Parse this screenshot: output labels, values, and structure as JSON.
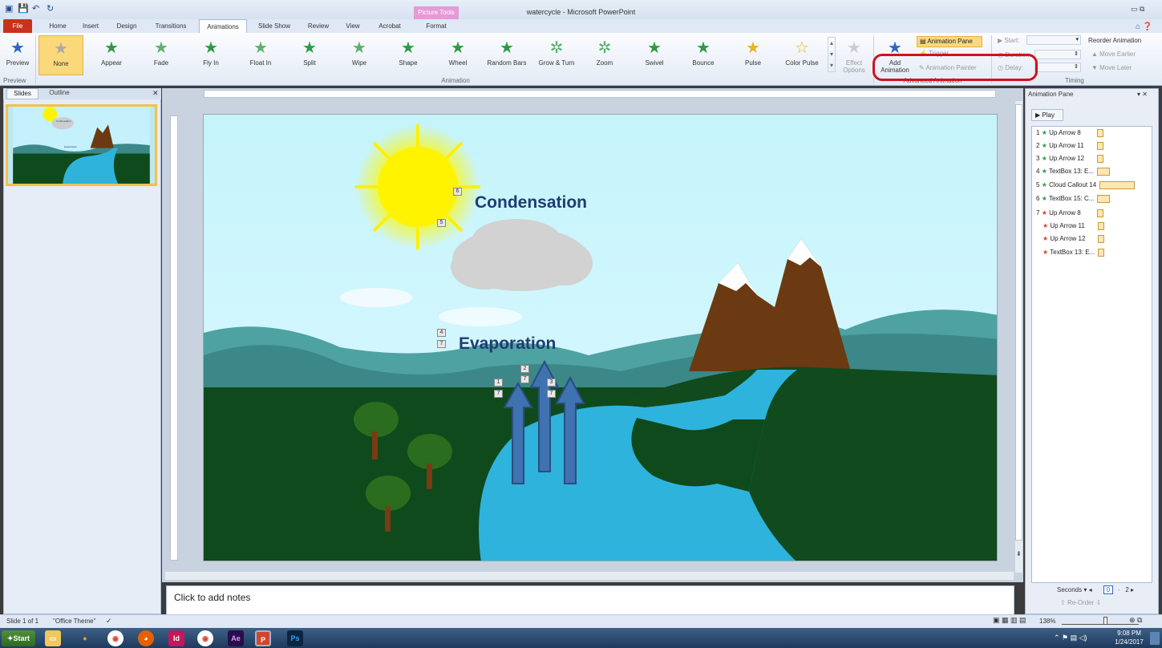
{
  "window": {
    "title": "watercycle - Microsoft PowerPoint",
    "context_tab": "Picture Tools"
  },
  "tabs": [
    "File",
    "Home",
    "Insert",
    "Design",
    "Transitions",
    "Animations",
    "Slide Show",
    "Review",
    "View",
    "Acrobat",
    "Format"
  ],
  "ribbon": {
    "preview_label": "Preview",
    "effects": [
      "None",
      "Appear",
      "Fade",
      "Fly In",
      "Float In",
      "Split",
      "Wipe",
      "Shape",
      "Wheel",
      "Random Bars",
      "Grow & Turn",
      "Zoom",
      "Swivel",
      "Bounce",
      "Pulse",
      "Color Pulse"
    ],
    "effect_options": "Effect Options",
    "add_animation": "Add Animation",
    "animation_pane": "Animation Pane",
    "trigger": "Trigger",
    "animation_painter": "Animation Painter",
    "start": "Start:",
    "duration": "Duration:",
    "delay": "Delay:",
    "reorder": "Reorder Animation",
    "move_earlier": "Move Earlier",
    "move_later": "Move Later",
    "groups": {
      "preview": "Preview",
      "animation": "Animation",
      "advanced": "Advanced Animation",
      "timing": "Timing"
    }
  },
  "left_pane": {
    "tab_slides": "Slides",
    "tab_outline": "Outline",
    "slide_number": "1"
  },
  "slide": {
    "condensation": "Condensation",
    "evaporation": "Evaporation"
  },
  "markers": {
    "m1": "1",
    "m2": "2",
    "m3": "3",
    "m4": "4",
    "m5": "5",
    "m6": "6",
    "m7": "7"
  },
  "thumbnail": {
    "condensation": "Condensation",
    "evaporation": "Evaporation"
  },
  "notes_placeholder": "Click to add notes",
  "animation_pane": {
    "title": "Animation Pane",
    "play": "Play",
    "items": [
      {
        "n": "1",
        "icon": "green-star",
        "label": "Up Arrow 8"
      },
      {
        "n": "2",
        "icon": "green-star",
        "label": "Up Arrow 11"
      },
      {
        "n": "3",
        "icon": "green-star",
        "label": "Up Arrow 12"
      },
      {
        "n": "4",
        "icon": "green-star",
        "label": "TextBox 13: E..."
      },
      {
        "n": "5",
        "icon": "green-star",
        "label": "Cloud Callout 14"
      },
      {
        "n": "6",
        "icon": "green-star",
        "label": "TextBox 15: C..."
      },
      {
        "n": "7",
        "icon": "red-star",
        "label": "Up Arrow 8"
      },
      {
        "n": "",
        "icon": "red-star",
        "label": "Up Arrow 11"
      },
      {
        "n": "",
        "icon": "red-star",
        "label": "Up Arrow 12"
      },
      {
        "n": "",
        "icon": "red-star",
        "label": "TextBox 13: E..."
      }
    ],
    "seconds": "Seconds",
    "tick0": "0",
    "tick2": "2",
    "reorder": "Re-Order"
  },
  "status": {
    "slide": "Slide 1 of 1",
    "theme": "\"Office Theme\"",
    "zoom": "138%"
  },
  "taskbar": {
    "start": "Start",
    "time": "9:08 PM",
    "date": "1/24/2017"
  },
  "colors": {
    "accent": "#d0121d",
    "tab_file": "#c8311b",
    "slide_sky": "#cdf3ff",
    "grass": "#0f4a1c",
    "water": "#2eb3dd",
    "mountain": "#6b3a12"
  }
}
